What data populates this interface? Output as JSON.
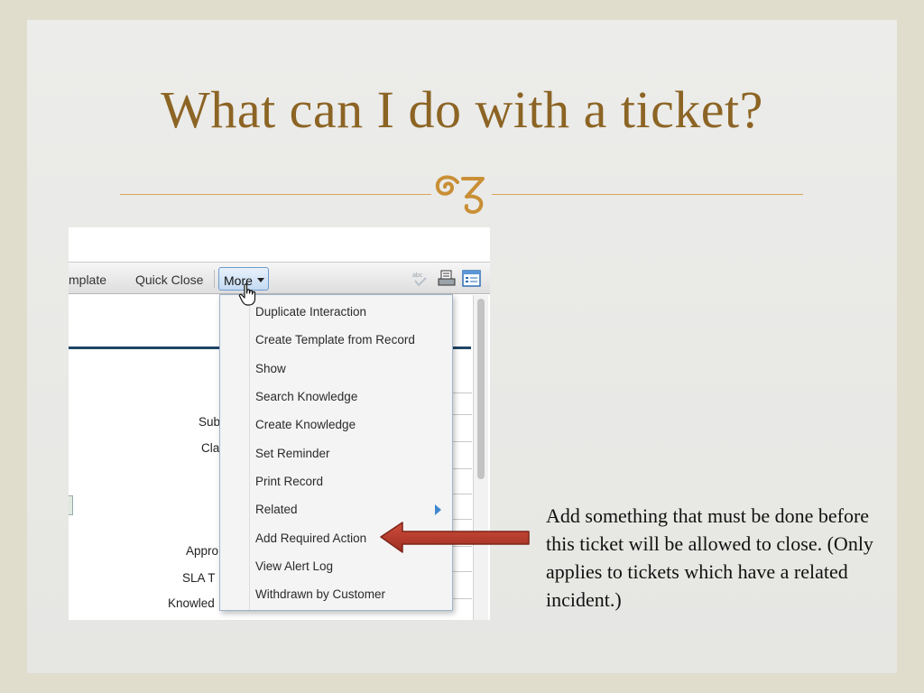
{
  "slide": {
    "title": "What can I do with a ticket?",
    "note": "Add something that must be done before this ticket will be allowed to close. (Only applies to tickets which have a related incident.)",
    "colors": {
      "title": "#8c6424",
      "divider": "#d8a85a",
      "arrow": "#b43a2b"
    }
  },
  "toolbar": {
    "template_label": "mplate",
    "quick_close_label": "Quick Close",
    "more_label": "More",
    "icons": [
      "spellcheck-icon",
      "print-icon",
      "list-view-icon"
    ]
  },
  "form": {
    "labels": [
      "Sub",
      "Cla",
      "Appro",
      "SLA T",
      "Knowled"
    ]
  },
  "menu": {
    "items": [
      "Duplicate Interaction",
      "Create Template from Record",
      "Show",
      "Search Knowledge",
      "Create Knowledge",
      "Set Reminder",
      "Print Record",
      "Related",
      "Add Required Action",
      "View Alert Log",
      "Withdrawn by Customer"
    ]
  }
}
